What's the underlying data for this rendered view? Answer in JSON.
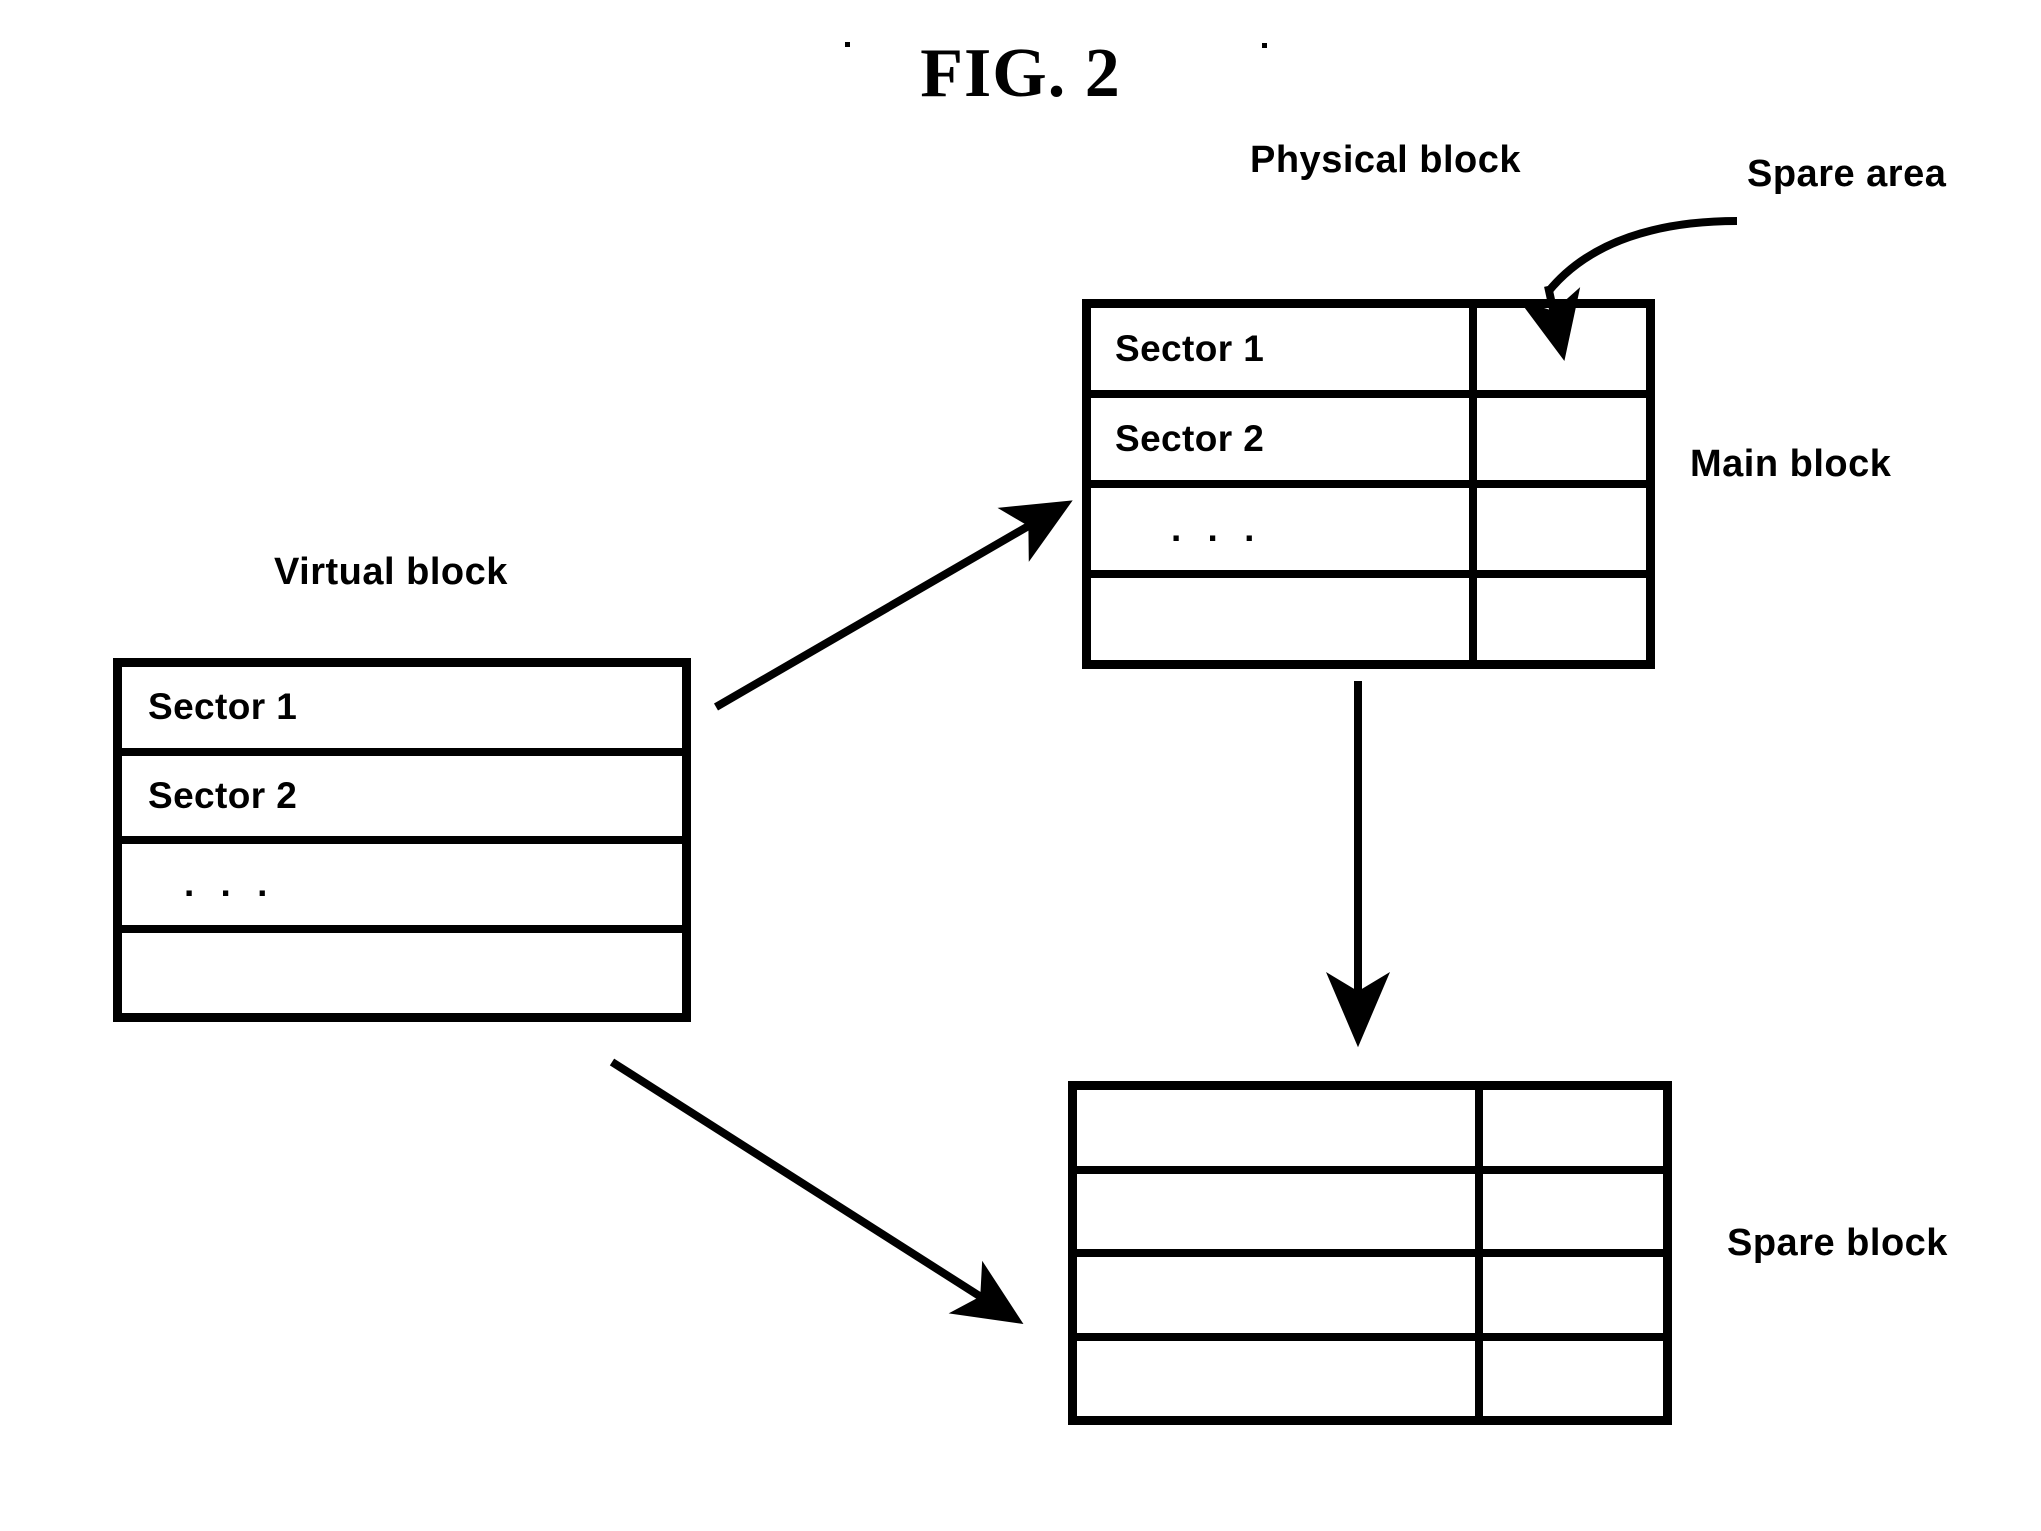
{
  "figure": {
    "title": "FIG. 2"
  },
  "labels": {
    "virtual_block": "Virtual block",
    "physical_block": "Physical block",
    "spare_area": "Spare area",
    "main_block": "Main block",
    "spare_block": "Spare block"
  },
  "virtual_block": {
    "name": "Virtual block",
    "columns": 1,
    "rows": [
      {
        "main": "Sector 1"
      },
      {
        "main": "Sector 2"
      },
      {
        "main": ". . ."
      },
      {
        "main": ""
      }
    ]
  },
  "physical_block": {
    "name": "Physical block",
    "columns": 2,
    "column_labels": [
      "Main block",
      "Spare area"
    ],
    "rows": [
      {
        "main": "Sector 1",
        "spare": ""
      },
      {
        "main": "Sector 2",
        "spare": ""
      },
      {
        "main": ". . .",
        "spare": ""
      },
      {
        "main": "",
        "spare": ""
      }
    ]
  },
  "spare_block": {
    "name": "Spare block",
    "columns": 2,
    "rows": [
      {
        "main": "",
        "spare": ""
      },
      {
        "main": "",
        "spare": ""
      },
      {
        "main": "",
        "spare": ""
      },
      {
        "main": "",
        "spare": ""
      }
    ]
  },
  "connectors": [
    {
      "name": "virtual-to-physical",
      "from": "Virtual block",
      "to": "Physical block",
      "style": "arrow"
    },
    {
      "name": "virtual-to-spare-block",
      "from": "Virtual block",
      "to": "Spare block",
      "style": "arrow"
    },
    {
      "name": "main-block-to-spare-block",
      "from": "Main block",
      "to": "Spare block",
      "style": "arrow"
    },
    {
      "name": "spare-area-leader",
      "from": "Spare area",
      "to": "Physical block spare column",
      "style": "curved-leader-arrow"
    }
  ],
  "colors": {
    "ink": "#000000",
    "background": "#ffffff"
  }
}
